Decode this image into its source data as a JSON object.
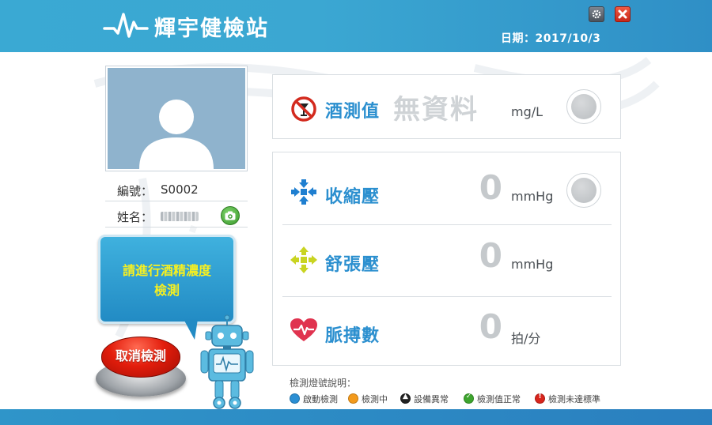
{
  "header": {
    "title": "輝宇健檢站",
    "date_label": "日期：2017/10/3",
    "settings_icon": "gear-icon",
    "close_icon": "close-icon"
  },
  "profile": {
    "id_label": "編號：",
    "id_value": "S0002",
    "name_label": "姓名：",
    "avatar_icon": "person-silhouette",
    "camera_icon": "camera-icon"
  },
  "prompt": {
    "line1": "請進行酒精濃度",
    "line2": "檢測"
  },
  "cancel_button": {
    "label": "取消檢測"
  },
  "measurements": {
    "alcohol": {
      "label": "酒測值",
      "value": "無資料",
      "unit": "mg/L",
      "icon": "no-alcohol-icon"
    },
    "systolic": {
      "label": "收縮壓",
      "value": "0",
      "unit": "mmHg",
      "icon": "arrows-inward-icon"
    },
    "diastolic": {
      "label": "舒張壓",
      "value": "0",
      "unit": "mmHg",
      "icon": "arrows-outward-icon"
    },
    "pulse": {
      "label": "脈搏數",
      "value": "0",
      "unit": "拍/分",
      "icon": "heart-pulse-icon"
    }
  },
  "legend": {
    "title": "檢測燈號說明：",
    "items": [
      {
        "label": "啟動檢測",
        "color": "#2b8fd4"
      },
      {
        "label": "檢測中",
        "color": "#f39a1c"
      },
      {
        "label": "設備異常",
        "color": "#222222"
      },
      {
        "label": "檢測值正常",
        "color": "#3ea52e"
      },
      {
        "label": "檢測未達標準",
        "color": "#d8251c"
      }
    ]
  },
  "colors": {
    "header": "#3aa9d3",
    "accent_label": "#2b8fcf",
    "prompt_text": "#f7f020",
    "cancel_red": "#e31d0c"
  }
}
